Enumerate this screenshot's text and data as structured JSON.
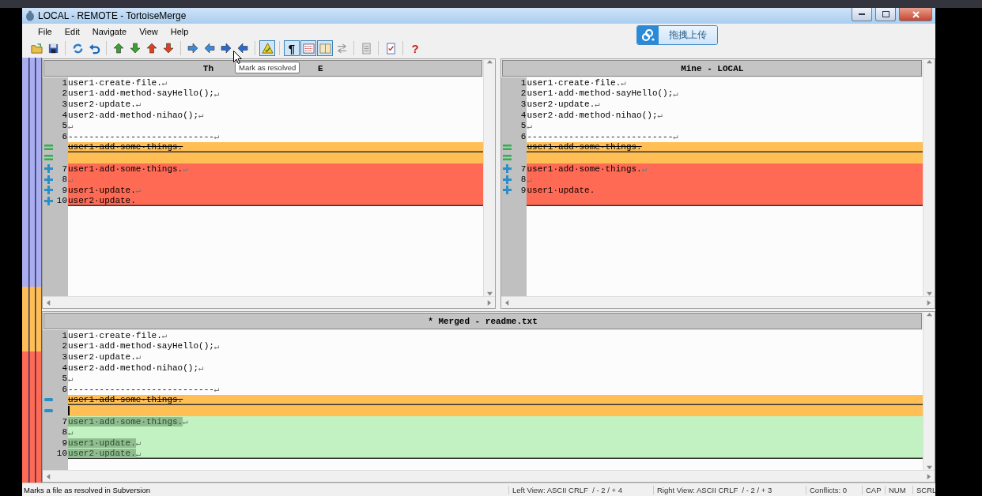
{
  "window": {
    "title": "LOCAL - REMOTE - TortoiseMerge"
  },
  "menu": [
    {
      "label": "File"
    },
    {
      "label": "Edit"
    },
    {
      "label": "Navigate"
    },
    {
      "label": "View"
    },
    {
      "label": "Help"
    }
  ],
  "toolbar": [
    {
      "kind": "button",
      "pressed": false
    },
    {
      "kind": "button",
      "pressed": false
    },
    {
      "kind": "separator"
    },
    {
      "kind": "button",
      "pressed": false
    },
    {
      "kind": "button",
      "pressed": false
    },
    {
      "kind": "separator"
    },
    {
      "kind": "button",
      "pressed": false
    },
    {
      "kind": "button",
      "pressed": false
    },
    {
      "kind": "button",
      "pressed": false
    },
    {
      "kind": "button",
      "pressed": false
    },
    {
      "kind": "separator"
    },
    {
      "kind": "button",
      "pressed": false
    },
    {
      "kind": "button",
      "pressed": false
    },
    {
      "kind": "button",
      "pressed": false
    },
    {
      "kind": "button",
      "pressed": false
    },
    {
      "kind": "separator"
    },
    {
      "kind": "button",
      "pressed": true
    },
    {
      "kind": "separator"
    },
    {
      "kind": "button",
      "pressed": true,
      "label": "¶"
    },
    {
      "kind": "button",
      "pressed": true
    },
    {
      "kind": "button",
      "pressed": true
    },
    {
      "kind": "button",
      "pressed": false
    },
    {
      "kind": "separator"
    },
    {
      "kind": "button",
      "pressed": false
    },
    {
      "kind": "separator"
    },
    {
      "kind": "button",
      "pressed": false
    },
    {
      "kind": "separator"
    },
    {
      "kind": "button",
      "pressed": false,
      "label": "?"
    }
  ],
  "tooltip": {
    "text": "Mark as resolved"
  },
  "upload_button": {
    "label": "拖拽上传"
  },
  "panes": [
    {
      "title_parts": [
        "Th",
        "E"
      ],
      "lines": [
        {
          "kind": "normal",
          "num": "1",
          "text": "user1·create·file.",
          "eol": "↵"
        },
        {
          "kind": "normal",
          "num": "2",
          "text": "user1·add·method·sayHello();",
          "eol": "↵"
        },
        {
          "kind": "normal",
          "num": "3",
          "text": "user2·update.",
          "eol": "↵"
        },
        {
          "kind": "normal",
          "num": "4",
          "text": "user2·add·method·nihao();",
          "eol": "↵"
        },
        {
          "kind": "normal",
          "num": "5",
          "eol": "↵"
        },
        {
          "kind": "normal",
          "num": "6",
          "text": "----------------------------",
          "eol": "↵"
        },
        {
          "kind": "conflict",
          "marker": {
            "kind": "equal"
          },
          "text": "user1·add·some·things.",
          "rule_below": true
        },
        {
          "kind": "conflict",
          "marker": {
            "kind": "equal"
          },
          "rule_below": false
        },
        {
          "kind": "added",
          "marker": {
            "kind": "plus"
          },
          "num": "7",
          "text": "user1·add·some·things.",
          "eol": "↵"
        },
        {
          "kind": "added",
          "marker": {
            "kind": "plus"
          },
          "num": "8",
          "eol": "↵"
        },
        {
          "kind": "added",
          "marker": {
            "kind": "plus"
          },
          "num": "9",
          "text": "user1·update.",
          "eol": "↵"
        },
        {
          "kind": "added",
          "marker": {
            "kind": "plus"
          },
          "num": "10",
          "text": "user2·update.",
          "rule_below": true
        }
      ]
    },
    {
      "title_parts": [
        "Mine - LOCAL"
      ],
      "lines": [
        {
          "kind": "normal",
          "num": "1",
          "text": "user1·create·file.",
          "eol": "↵"
        },
        {
          "kind": "normal",
          "num": "2",
          "text": "user1·add·method·sayHello();",
          "eol": "↵"
        },
        {
          "kind": "normal",
          "num": "3",
          "text": "user2·update.",
          "eol": "↵"
        },
        {
          "kind": "normal",
          "num": "4",
          "text": "user2·add·method·nihao();",
          "eol": "↵"
        },
        {
          "kind": "normal",
          "num": "5",
          "eol": "↵"
        },
        {
          "kind": "normal",
          "num": "6",
          "text": "----------------------------",
          "eol": "↵"
        },
        {
          "kind": "conflict",
          "marker": {
            "kind": "equal"
          },
          "text": "user1·add·some·things.",
          "rule_below": true
        },
        {
          "kind": "conflict",
          "marker": {
            "kind": "equal"
          },
          "rule_below": false
        },
        {
          "kind": "added",
          "marker": {
            "kind": "plus"
          },
          "num": "7",
          "text": "user1·add·some·things.",
          "eol": "↵"
        },
        {
          "kind": "added",
          "marker": {
            "kind": "plus"
          },
          "num": "8",
          "eol": "↵"
        },
        {
          "kind": "added",
          "marker": {
            "kind": "plus"
          },
          "num": "9",
          "text": "user1·update."
        },
        {
          "kind": "added",
          "rule_below": true
        }
      ]
    }
  ],
  "merged": {
    "title": "* Merged - readme.txt",
    "lines": [
      {
        "kind": "normal",
        "num": "1",
        "text": "user1·create·file.",
        "eol": "↵"
      },
      {
        "kind": "normal",
        "num": "2",
        "text": "user1·add·method·sayHello();",
        "eol": "↵"
      },
      {
        "kind": "normal",
        "num": "3",
        "text": "user2·update.",
        "eol": "↵"
      },
      {
        "kind": "normal",
        "num": "4",
        "text": "user2·add·method·nihao();",
        "eol": "↵"
      },
      {
        "kind": "normal",
        "num": "5",
        "eol": "↵"
      },
      {
        "kind": "normal",
        "num": "6",
        "text": "----------------------------",
        "eol": "↵"
      },
      {
        "kind": "conflict",
        "marker": {
          "kind": "minus"
        },
        "text": "user1·add·some·things.",
        "rule_below": true
      },
      {
        "kind": "conflict",
        "marker": {
          "kind": "minus"
        },
        "cursor": true,
        "rule_below": false
      },
      {
        "kind": "resolved",
        "num": "7",
        "text": "user1·add·some·things.",
        "eol": "↵"
      },
      {
        "kind": "resolved",
        "num": "8",
        "eol": "↵"
      },
      {
        "kind": "resolved",
        "num": "9",
        "text": "user1·update.",
        "eol": "↵"
      },
      {
        "kind": "resolved",
        "num": "10",
        "text": "user2·update.",
        "eol": "↵",
        "rule_below": true
      }
    ]
  },
  "status_bar": {
    "message": "Marks a file as resolved in Subversion",
    "panels": [
      "Left View: ASCII CRLF  / - 2 / + 4",
      "Right View: ASCII CRLF  / - 2 / + 3",
      "Conflicts: 0",
      "CAP",
      "NUM",
      "SCRL"
    ]
  }
}
